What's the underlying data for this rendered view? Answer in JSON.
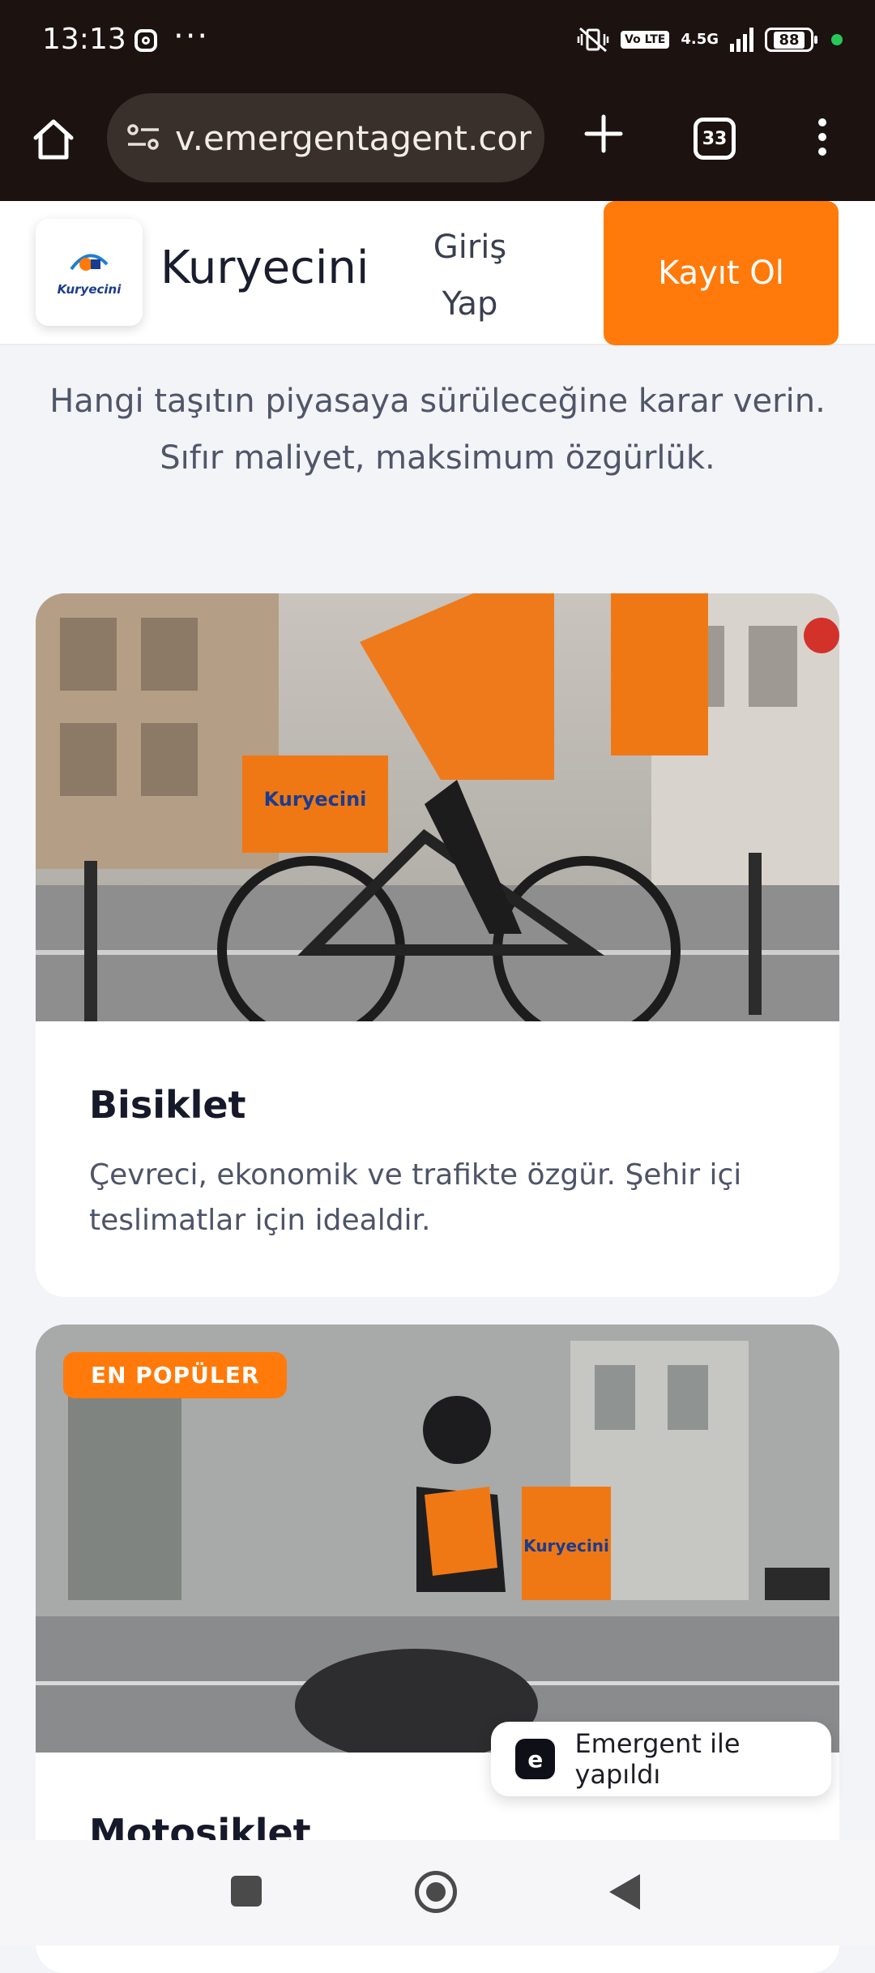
{
  "status_bar": {
    "time": "13:13",
    "network": "4.5G",
    "volte": "Vo LTE",
    "battery": "88"
  },
  "browser": {
    "url": "v.emergentagent.com",
    "tab_count": "33"
  },
  "header": {
    "brand": "Kuryecini",
    "logo_text": "Kuryecini",
    "login_label": "Giriş Yap",
    "signup_label": "Kayıt Ol"
  },
  "intro": "Hangi taşıtın piyasaya sürüleceğine karar verin. Sıfır maliyet, maksimum özgürlük.",
  "vehicles": [
    {
      "title": "Bisiklet",
      "description": "Çevreci, ekonomik ve trafikte özgür. Şehir içi teslimatlar için idealdir.",
      "image_box_label": "Kuryecini"
    },
    {
      "badge": "EN POPÜLER",
      "title": "Motosiklet",
      "image_box_label": "Kuryecini"
    }
  ],
  "emergent_badge": "Emergent ile yapıldı",
  "colors": {
    "accent": "#ff7a0a",
    "dark": "#1c1210",
    "page_bg": "#f2f4f8"
  }
}
